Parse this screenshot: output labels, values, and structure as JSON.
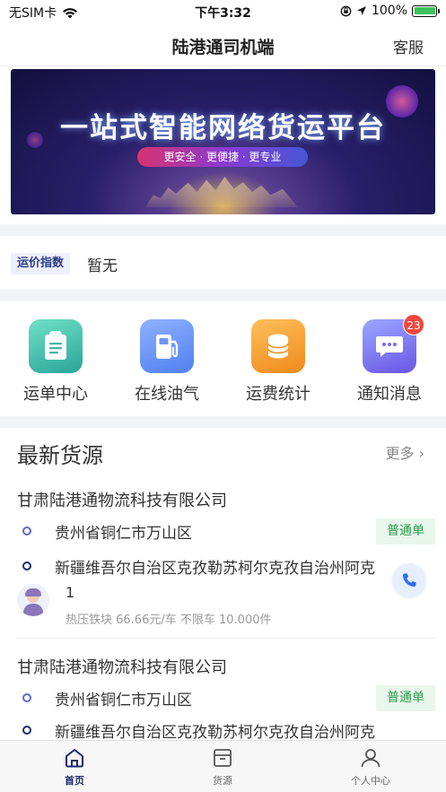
{
  "status_bar": {
    "carrier": "无SIM卡",
    "time": "下午3:32",
    "battery": "100%"
  },
  "header": {
    "title": "陆港通司机端",
    "service": "客服"
  },
  "banner": {
    "headline": "一站式智能网络货运平台",
    "tagline": "更安全 · 更便捷 · 更专业"
  },
  "freight_index": {
    "label": "运价指数",
    "value": "暂无"
  },
  "menu": [
    {
      "label": "运单中心",
      "icon": "waybill-icon",
      "color": "#3fb6a4"
    },
    {
      "label": "在线油气",
      "icon": "fuel-pump-icon",
      "color": "#5b8ff5"
    },
    {
      "label": "运费统计",
      "icon": "coin-stack-icon",
      "color": "#f39a2b"
    },
    {
      "label": "通知消息",
      "icon": "message-icon",
      "color": "#7a6bf0",
      "badge": "23"
    }
  ],
  "latest": {
    "title": "最新货源",
    "more": "更多",
    "cards": [
      {
        "company": "甘肃陆港通物流科技有限公司",
        "origin": "贵州省铜仁市万山区",
        "destination": "新疆维吾尔自治区克孜勒苏柯尔克孜自治州阿克",
        "tag": "普通单",
        "driver": "1",
        "info": "热压铁块 66.66元/车 不限车 10.000件"
      },
      {
        "company": "甘肃陆港通物流科技有限公司",
        "origin": "贵州省铜仁市万山区",
        "destination": "新疆维吾尔自治区克孜勒苏柯尔克孜自治州阿克",
        "tag": "普通单"
      }
    ]
  },
  "tabs": [
    {
      "label": "首页",
      "icon": "home-icon",
      "active": true
    },
    {
      "label": "货源",
      "icon": "cargo-box-icon",
      "active": false
    },
    {
      "label": "个人中心",
      "icon": "user-icon",
      "active": false
    }
  ],
  "colors": {
    "primary": "#1f2a6b",
    "tag_green": "#2e9a4b",
    "badge_red": "#f2463d"
  }
}
